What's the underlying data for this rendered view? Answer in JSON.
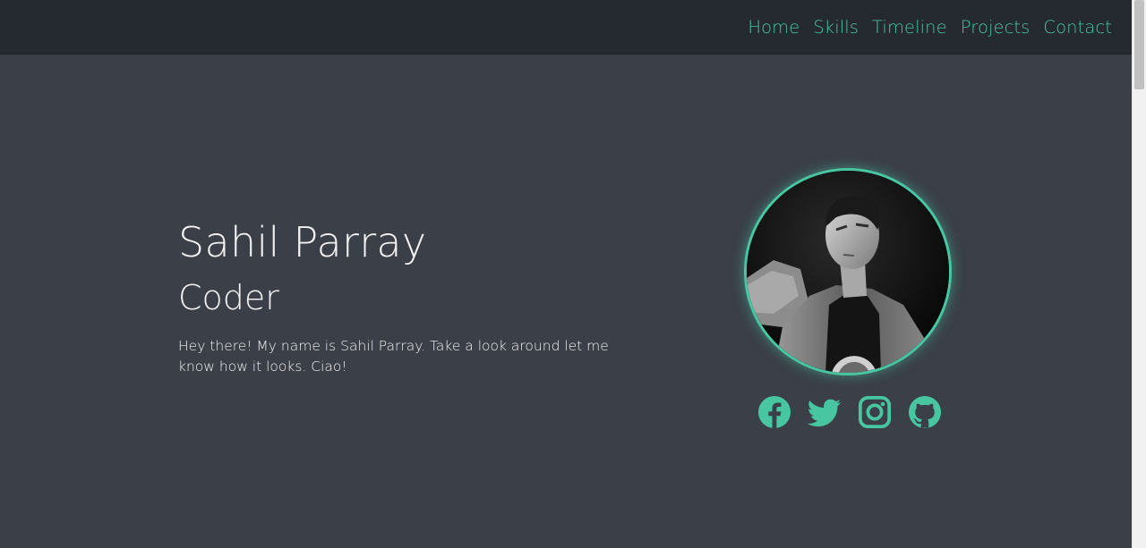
{
  "nav": {
    "links": [
      "Home",
      "Skills",
      "Timeline",
      "Projects",
      "Contact"
    ]
  },
  "hero": {
    "name": "Sahil Parray",
    "role": "Coder",
    "intro": "Hey there! My name is Sahil Parray. Take a look around let me know how it looks. Ciao!"
  },
  "socials": [
    {
      "icon": "facebook-icon"
    },
    {
      "icon": "twitter-icon"
    },
    {
      "icon": "instagram-icon"
    },
    {
      "icon": "github-icon"
    }
  ],
  "colors": {
    "accent": "#47c6a1",
    "navbar_bg": "#252a31",
    "page_bg": "#3a3f48",
    "text": "#f2f2f2"
  }
}
